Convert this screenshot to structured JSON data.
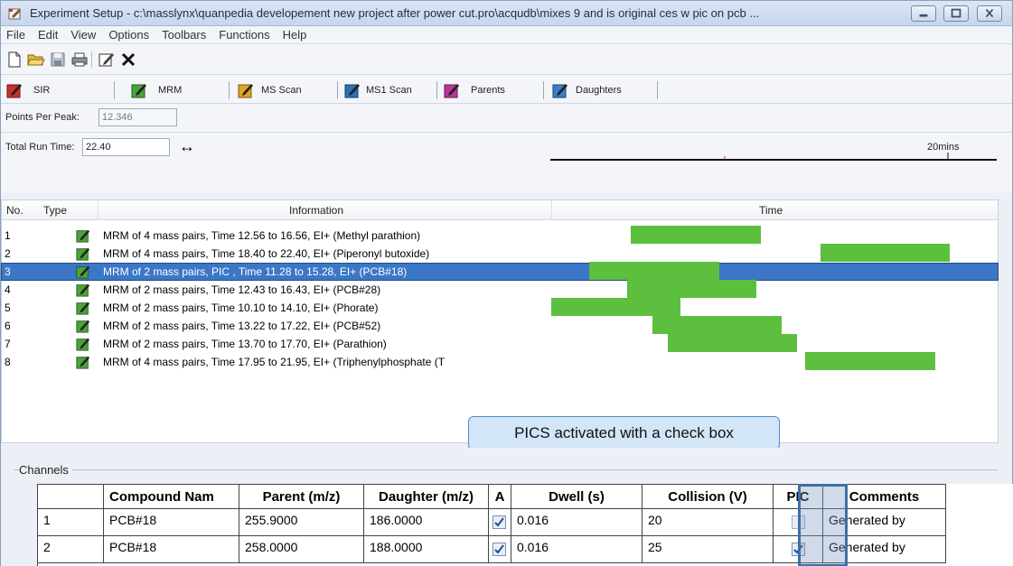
{
  "window": {
    "title": "Experiment Setup - c:\\masslynx\\quanpedia developement new project after power cut.pro\\acqudb\\mixes 9 and is original ces w pic on pcb ..."
  },
  "menu": [
    "File",
    "Edit",
    "View",
    "Options",
    "Toolbars",
    "Functions",
    "Help"
  ],
  "toolbar": {
    "icons": [
      "new-file-icon",
      "open-folder-icon",
      "save-icon",
      "print-icon",
      "edit-icon",
      "delete-icon"
    ]
  },
  "scan_toolbar": {
    "buttons": [
      {
        "label": "SIR",
        "color": "#c8302c"
      },
      {
        "label": "MRM",
        "color": "#4aa33a"
      },
      {
        "label": "MS Scan",
        "color": "#e2a51f"
      },
      {
        "label": "MS1 Scan",
        "color": "#2f6fb5"
      },
      {
        "label": "Parents",
        "color": "#b8379a"
      },
      {
        "label": "Daughters",
        "color": "#3a7fc9"
      }
    ]
  },
  "points_per_peak": {
    "label": "Points Per Peak:",
    "value": "12.346"
  },
  "total_run_time": {
    "label": "Total Run Time:",
    "value": "22.40",
    "arrow": "↔",
    "scale_label": "20mins",
    "max_minutes": 22.4
  },
  "functions_grid": {
    "headers": {
      "no": "No.",
      "type": "Type",
      "information": "Information",
      "time": "Time"
    },
    "rows": [
      {
        "no": "1",
        "info": "MRM of 4 mass pairs, Time 12.56 to 16.56, EI+ (Methyl parathion)",
        "start": 12.56,
        "end": 16.56,
        "selected": false
      },
      {
        "no": "2",
        "info": "MRM of 4 mass pairs, Time 18.40 to 22.40, EI+ (Piperonyl butoxide)",
        "start": 18.4,
        "end": 22.4,
        "selected": false
      },
      {
        "no": "3",
        "info": "MRM of 2 mass pairs, PIC , Time 11.28 to 15.28, EI+ (PCB#18)",
        "start": 11.28,
        "end": 15.28,
        "selected": true
      },
      {
        "no": "4",
        "info": "MRM of 2 mass pairs, Time 12.43 to 16.43, EI+ (PCB#28)",
        "start": 12.43,
        "end": 16.43,
        "selected": false
      },
      {
        "no": "5",
        "info": "MRM of 2 mass pairs, Time 10.10 to 14.10, EI+ (Phorate)",
        "start": 10.1,
        "end": 14.1,
        "selected": false
      },
      {
        "no": "6",
        "info": "MRM of 2 mass pairs, Time 13.22 to 17.22, EI+ (PCB#52)",
        "start": 13.22,
        "end": 17.22,
        "selected": false
      },
      {
        "no": "7",
        "info": "MRM of 2 mass pairs, Time 13.70 to 17.70, EI+ (Parathion)",
        "start": 13.7,
        "end": 17.7,
        "selected": false
      },
      {
        "no": "8",
        "info": "MRM of 4 mass pairs, Time 17.95 to 21.95, EI+ (Triphenylphosphate (T",
        "start": 17.95,
        "end": 21.95,
        "selected": false
      }
    ]
  },
  "callout": {
    "text": "PICS activated with a check box"
  },
  "channels": {
    "legend": "Channels",
    "headers": [
      "",
      "Compound Nam",
      "Parent (m/z)",
      "Daughter (m/z)",
      "A",
      "Dwell (s)",
      "Collision (V)",
      "PIC",
      "Comments"
    ],
    "rows": [
      {
        "idx": "1",
        "compound": "PCB#18",
        "parent": "255.9000",
        "daughter": "186.0000",
        "auto": true,
        "dwell": "0.016",
        "collision": "20",
        "pic": false,
        "comments": "Generated by"
      },
      {
        "idx": "2",
        "compound": "PCB#18",
        "parent": "258.0000",
        "daughter": "188.0000",
        "auto": true,
        "dwell": "0.016",
        "collision": "25",
        "pic": true,
        "comments": "Generated by"
      }
    ]
  }
}
